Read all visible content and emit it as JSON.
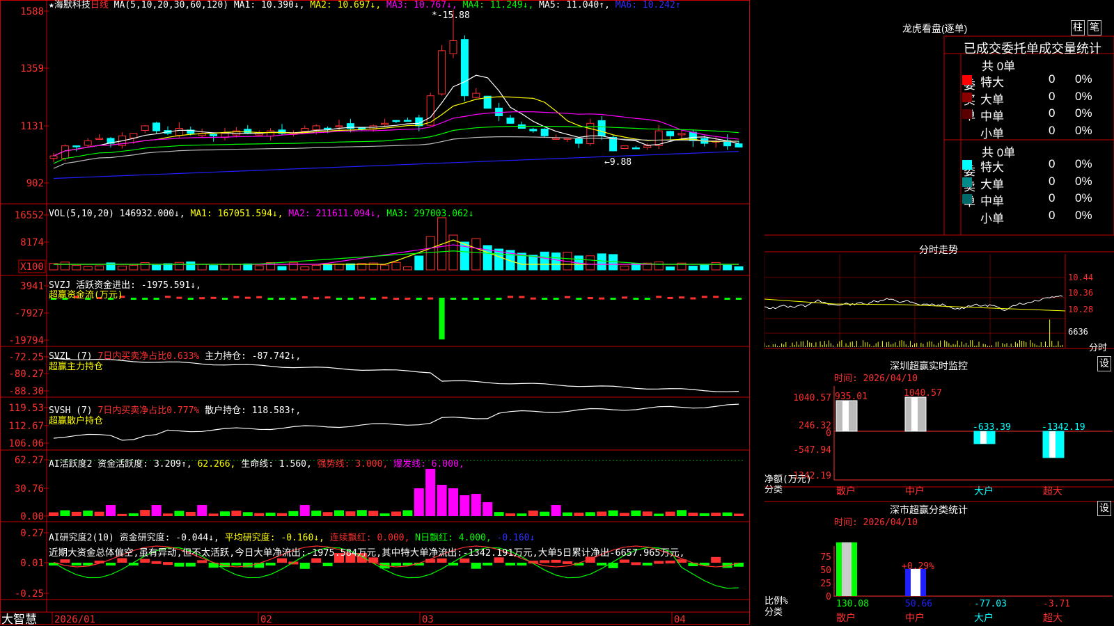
{
  "app": {
    "brand": "大智慧"
  },
  "kline": {
    "title_parts": [
      {
        "text": "★海默科技",
        "color": "#ffffff"
      },
      {
        "text": "日线",
        "color": "#ff3030"
      },
      {
        "text": " MA(5,10,20,30,60,120)",
        "color": "#ffffff"
      },
      {
        "text": " MA1: 10.390↓,",
        "color": "#ffffff"
      },
      {
        "text": " MA2: 10.697↓,",
        "color": "#ffff00"
      },
      {
        "text": " MA3: 10.767↓,",
        "color": "#ff00ff"
      },
      {
        "text": " MA4: 11.249↓,",
        "color": "#00ff00"
      },
      {
        "text": " MA5: 11.040↑,",
        "color": "#ffffff"
      },
      {
        "text": " MA6: 10.242↑",
        "color": "#3030ff"
      }
    ],
    "y_ticks": [
      "1588",
      "1359",
      "1131",
      "902"
    ],
    "y_values": [
      15.88,
      13.59,
      11.31,
      9.02
    ],
    "high_label": "15.88",
    "low_label": "9.88"
  },
  "volume": {
    "title_parts": [
      {
        "text": "VOL(5,10,20)",
        "color": "#ffffff"
      },
      {
        "text": " 146932.000↓,",
        "color": "#ffffff"
      },
      {
        "text": " MA1: 167051.594↓,",
        "color": "#ffff00"
      },
      {
        "text": " MA2: 211611.094↓,",
        "color": "#ff00ff"
      },
      {
        "text": " MA3: 297003.062↓",
        "color": "#00ff00"
      }
    ],
    "y_ticks": [
      "16552",
      "8174"
    ],
    "unit_label": "X100"
  },
  "svzj": {
    "title_parts": [
      {
        "text": "SVZJ  活跃资金进出: -1975.591↓,",
        "color": "#ffffff"
      }
    ],
    "subtitle": "超赢资金流(万元)",
    "y_ticks": [
      "3941",
      "-7927",
      "-19794"
    ]
  },
  "svzl": {
    "title_parts": [
      {
        "text": "SVZL (7) ",
        "color": "#ffffff"
      },
      {
        "text": "7日内买卖净占比0.633%",
        "color": "#ff3030"
      },
      {
        "text": " 主力持仓: -87.742↓,",
        "color": "#ffffff"
      }
    ],
    "subtitle": "超赢主力持仓",
    "y_ticks": [
      "-72.25",
      "-80.27",
      "-88.30"
    ]
  },
  "svsh": {
    "title_parts": [
      {
        "text": "SVSH (7) ",
        "color": "#ffffff"
      },
      {
        "text": "7日内买卖净占比0.777%",
        "color": "#ff3030"
      },
      {
        "text": " 散户持仓: 118.583↑,",
        "color": "#ffffff"
      }
    ],
    "subtitle": "超赢散户持仓",
    "y_ticks": [
      "119.53",
      "112.67",
      "106.06"
    ]
  },
  "ai_active": {
    "title_parts": [
      {
        "text": "AI活跃度2 资金活跃度: 3.209↑,",
        "color": "#ffffff"
      },
      {
        "text": " 62.266,",
        "color": "#ffff00"
      },
      {
        "text": " 生命线: 1.560,",
        "color": "#ffffff"
      },
      {
        "text": " 强势线: 3.000,",
        "color": "#ff3030"
      },
      {
        "text": " 爆发线: 6.000,",
        "color": "#ff00ff"
      }
    ],
    "y_ticks": [
      "62.27",
      "30.76",
      "0.00"
    ]
  },
  "ai_research": {
    "title_parts": [
      {
        "text": "AI研究度2(10) 资金研究度: -0.044↓,",
        "color": "#ffffff"
      },
      {
        "text": " 平均研究度: -0.160↓,",
        "color": "#ffff00"
      },
      {
        "text": " 连续飘红: 0.000,",
        "color": "#ff3030"
      },
      {
        "text": " N日飘红: 4.000,",
        "color": "#00ff00"
      },
      {
        "text": " -0.160↓",
        "color": "#3030ff"
      }
    ],
    "commentary": "近期大资金总体偏空,虽有异动,但不太活跃,今日大单净流出:-1975.584万元,其中特大单净流出:-1342.191万元,大单5日累计净出-6657.965万元,",
    "y_ticks": [
      "0.27",
      "0.01",
      "-0.25"
    ]
  },
  "dates": [
    "2026/01",
    "02",
    "03",
    "04"
  ],
  "dragon_tiger": {
    "title": "龙虎看盘(逐单)",
    "btn1": "柱",
    "btn2": "笔",
    "header": "已成交委托单成交量统计",
    "buy": {
      "label": "委买单",
      "total": "共 0单",
      "rows": [
        {
          "name": "特大",
          "value": "0",
          "pct": "0%",
          "color": "#ff0000"
        },
        {
          "name": "大单",
          "value": "0",
          "pct": "0%",
          "color": "#8a0000"
        },
        {
          "name": "中单",
          "value": "0",
          "pct": "0%",
          "color": "#5a0000"
        },
        {
          "name": "小单",
          "value": "0",
          "pct": "0%",
          "color": ""
        }
      ]
    },
    "sell": {
      "label": "委卖单",
      "total": "共 0单",
      "rows": [
        {
          "name": "特大",
          "value": "0",
          "pct": "0%",
          "color": "#00ffff"
        },
        {
          "name": "大单",
          "value": "0",
          "pct": "0%",
          "color": "#008a8a"
        },
        {
          "name": "中单",
          "value": "0",
          "pct": "0%",
          "color": "#006a6a"
        },
        {
          "name": "小单",
          "value": "0",
          "pct": "0%",
          "color": ""
        }
      ]
    }
  },
  "intraday": {
    "title": "分时走势",
    "y_ticks": [
      "10.44",
      "10.36",
      "10.28",
      "6636"
    ],
    "footer": "分时"
  },
  "monitor": {
    "title": "深圳超赢实时监控",
    "btn": "设",
    "time": "时间: 2026/04/10",
    "y_ticks": [
      "1040.57",
      "246.32",
      "0",
      "-547.94",
      "-1342.19"
    ],
    "ylabel": "净额(万元)",
    "xlabel": "分类"
  },
  "class_stats": {
    "title": "深市超赢分类统计",
    "btn": "设",
    "time": "时间: 2026/04/10",
    "y_ticks": [
      "75",
      "50",
      "25",
      "0"
    ],
    "ylabel": "比例%",
    "xlabel": "分类"
  },
  "chart_data": [
    {
      "type": "bar",
      "title": "深圳超赢实时监控",
      "categories": [
        "散户",
        "中户",
        "大户",
        "超大"
      ],
      "values": [
        935.01,
        1040.57,
        -633.39,
        -1342.19
      ],
      "ylabel": "净额(万元)",
      "xlabel": "分类",
      "ylim": [
        -1342.19,
        1040.57
      ]
    },
    {
      "type": "bar",
      "title": "深市超赢分类统计",
      "categories": [
        "散户",
        "中户",
        "大户",
        "超大"
      ],
      "values": [
        130.08,
        50.66,
        -77.03,
        -3.71
      ],
      "annotations": [
        "+0.29%"
      ],
      "ylabel": "比例%",
      "xlabel": "分类",
      "ylim": [
        0,
        75
      ]
    }
  ],
  "colors": {
    "up": "#ff3030",
    "down": "#00ffff",
    "border": "#c80000",
    "bg": "#000000"
  }
}
